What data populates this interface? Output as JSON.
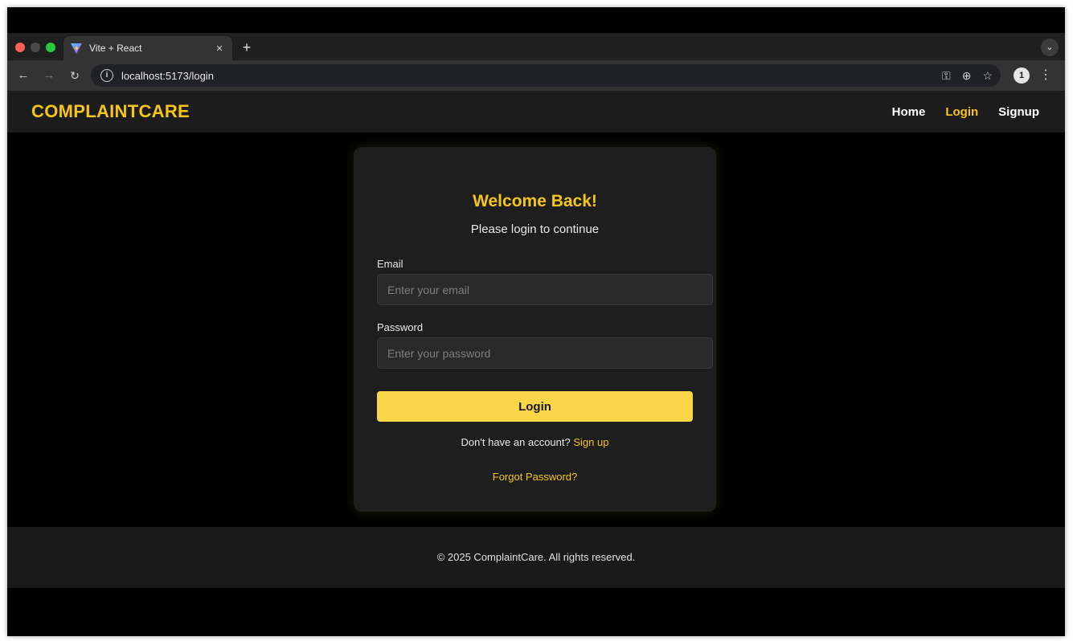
{
  "browser": {
    "tab_title": "Vite + React",
    "tab_close": "×",
    "new_tab": "+",
    "url": "localhost:5173/login",
    "profile_initial": "1",
    "icons": [
      "back-arrow-icon",
      "forward-arrow-icon",
      "reload-icon",
      "site-info-icon",
      "password-key-icon",
      "zoom-icon",
      "bookmark-star-icon",
      "menu-dots-icon"
    ]
  },
  "navbar": {
    "brand": "COMPLAINTCARE",
    "links": [
      {
        "label": "Home"
      },
      {
        "label": "Login"
      },
      {
        "label": "Signup"
      }
    ]
  },
  "login": {
    "title": "Welcome Back!",
    "subtitle": "Please login to continue",
    "email_label": "Email",
    "email_placeholder": "Enter your email",
    "password_label": "Password",
    "password_placeholder": "Enter your password",
    "submit_label": "Login",
    "signup_prompt": "Don't have an account?",
    "signup_link": "Sign up",
    "forgot_link": "Forgot Password?"
  },
  "footer": {
    "text": "© 2025 ComplaintCare. All rights reserved."
  },
  "colors": {
    "accent": "#f5c518",
    "button": "#f9d548",
    "background": "#000000",
    "card": "#1e1e1e"
  }
}
